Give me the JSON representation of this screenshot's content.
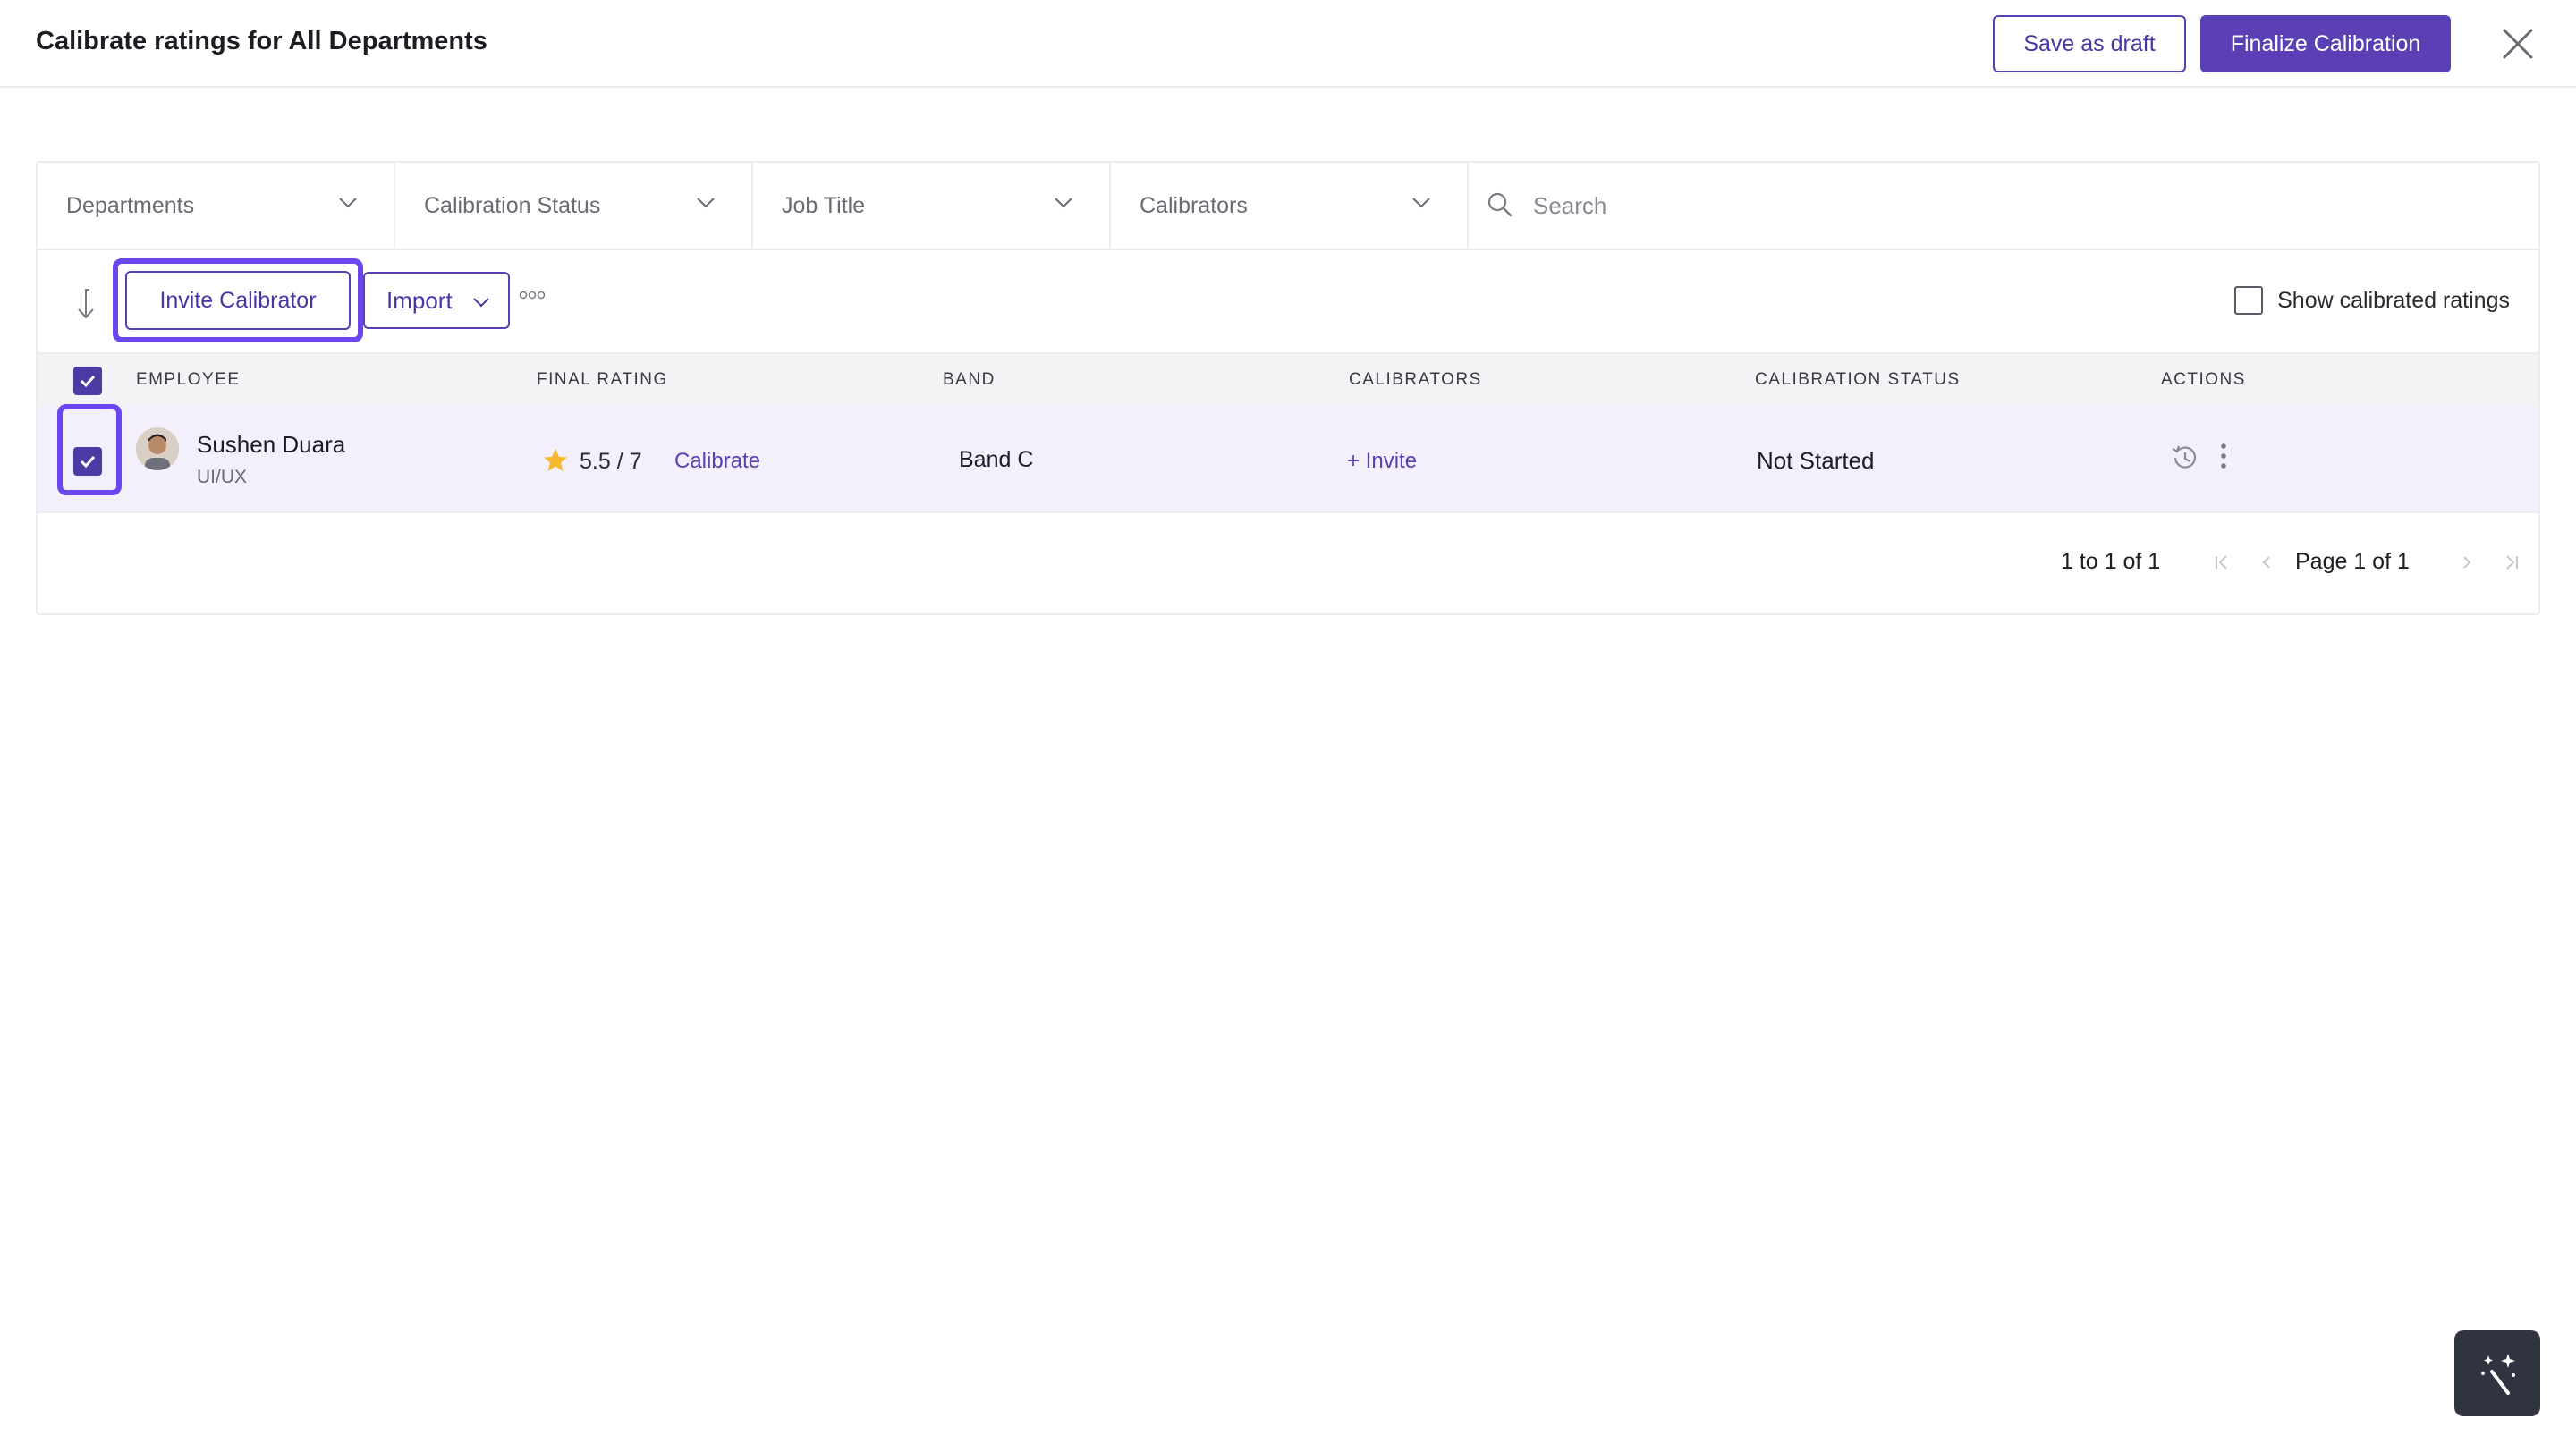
{
  "header": {
    "title": "Calibrate ratings for All Departments",
    "save_draft_label": "Save as draft",
    "finalize_label": "Finalize Calibration"
  },
  "filters": [
    {
      "label": "Departments"
    },
    {
      "label": "Calibration Status"
    },
    {
      "label": "Job Title"
    },
    {
      "label": "Calibrators"
    }
  ],
  "search": {
    "placeholder": "Search",
    "value": ""
  },
  "toolbar": {
    "invite_label": "Invite Calibrator",
    "import_label": "Import",
    "show_calibrated_label": "Show calibrated ratings",
    "show_calibrated_checked": false
  },
  "table": {
    "columns": [
      "EMPLOYEE",
      "FINAL RATING",
      "BAND",
      "CALIBRATORS",
      "CALIBRATION STATUS",
      "ACTIONS"
    ],
    "rows": [
      {
        "name": "Sushen Duara",
        "role": "UI/UX",
        "rating": "5.5 / 7",
        "calibrate_label": "Calibrate",
        "band": "Band C",
        "calibrators_label": "+ Invite",
        "status": "Not Started",
        "selected": true
      }
    ]
  },
  "pagination": {
    "count_text": "1 to 1 of 1",
    "page_text": "Page 1 of 1"
  },
  "colors": {
    "accent": "#5a3fb5",
    "highlight": "#6b46ef",
    "row_selected_bg": "#f3f0fb",
    "star": "#f5b82e"
  },
  "icons": [
    "close-icon",
    "chevron-down-icon",
    "search-icon",
    "sort-icon",
    "more-icon",
    "star-icon",
    "history-icon",
    "kebab-icon",
    "magic-wand-icon"
  ]
}
